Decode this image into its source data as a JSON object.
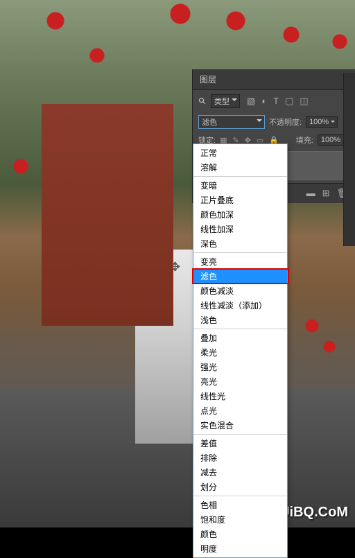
{
  "watermark": "UiBQ.CoM",
  "panel": {
    "tab": "图层",
    "type_filter": "类型",
    "blend_mode": "滤色",
    "opacity_label": "不透明度:",
    "opacity_value": "100%",
    "lock_label": "锁定:",
    "fill_label": "填充:",
    "fill_value": "100%"
  },
  "blend_modes": {
    "g1": [
      "正常",
      "溶解"
    ],
    "g2": [
      "变暗",
      "正片叠底",
      "颜色加深",
      "线性加深",
      "深色"
    ],
    "g3": [
      "变亮",
      "滤色",
      "颜色减淡",
      "线性减淡（添加）",
      "浅色"
    ],
    "g4": [
      "叠加",
      "柔光",
      "强光",
      "亮光",
      "线性光",
      "点光",
      "实色混合"
    ],
    "g5": [
      "差值",
      "排除",
      "减去",
      "划分"
    ],
    "g6": [
      "色相",
      "饱和度",
      "颜色",
      "明度"
    ]
  },
  "selected_mode": "滤色"
}
